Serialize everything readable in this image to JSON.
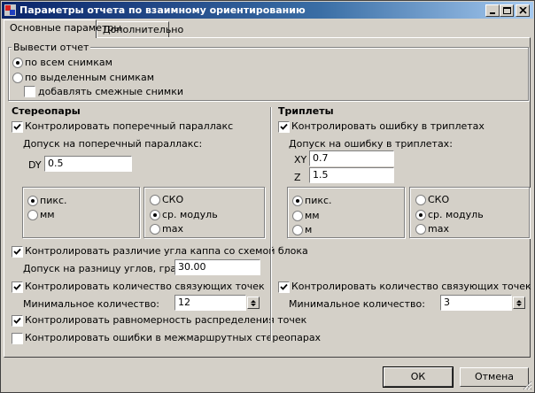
{
  "window": {
    "title": "Параметры отчета по взаимному ориентированию"
  },
  "tabs": [
    {
      "label": "Основные параметры"
    },
    {
      "label": "Дополнительно"
    }
  ],
  "output": {
    "group_label": "Вывести отчет",
    "radio_all": "по всем снимкам",
    "radio_selected": "по выделенным снимкам",
    "add_adjacent": "добавлять смежные снимки"
  },
  "stereo": {
    "title": "Стереопары",
    "check_parallax": "Контролировать поперечный параллакс",
    "tolerance_label": "Допуск на поперечный параллакс:",
    "dy_label": "DY",
    "dy_value": "0.5",
    "unit_pix": "пикс.",
    "unit_mm": "мм",
    "stat_rms": "СКО",
    "stat_mean": "ср. модуль",
    "stat_max": "max",
    "check_kappa": "Контролировать различие угла каппа со схемой блока",
    "kappa_label": "Допуск на разницу углов, градусы:",
    "kappa_value": "30.00",
    "check_tie": "Контролировать количество связующих точек",
    "min_count_label": "Минимальное количество:",
    "min_count_value": "12",
    "check_uniform": "Контролировать равномерность распределения точек",
    "check_interroute": "Контролировать ошибки в межмаршрутных стереопарах"
  },
  "triplets": {
    "title": "Триплеты",
    "check_error": "Контролировать ошибку в триплетах",
    "tolerance_label": "Допуск на ошибку в триплетах:",
    "xy_label": "XY",
    "xy_value": "0.7",
    "z_label": "Z",
    "z_value": "1.5",
    "unit_pix": "пикс.",
    "unit_mm": "мм",
    "unit_m": "м",
    "stat_rms": "СКО",
    "stat_mean": "ср. модуль",
    "stat_max": "max",
    "check_tie": "Контролировать количество связующих точек",
    "min_count_label": "Минимальное количество:",
    "min_count_value": "3"
  },
  "buttons": {
    "ok": "ОК",
    "cancel": "Отмена"
  },
  "colors": {
    "titlebar_start": "#0a246a",
    "titlebar_end": "#a6caf0",
    "face": "#d4d0c8"
  }
}
